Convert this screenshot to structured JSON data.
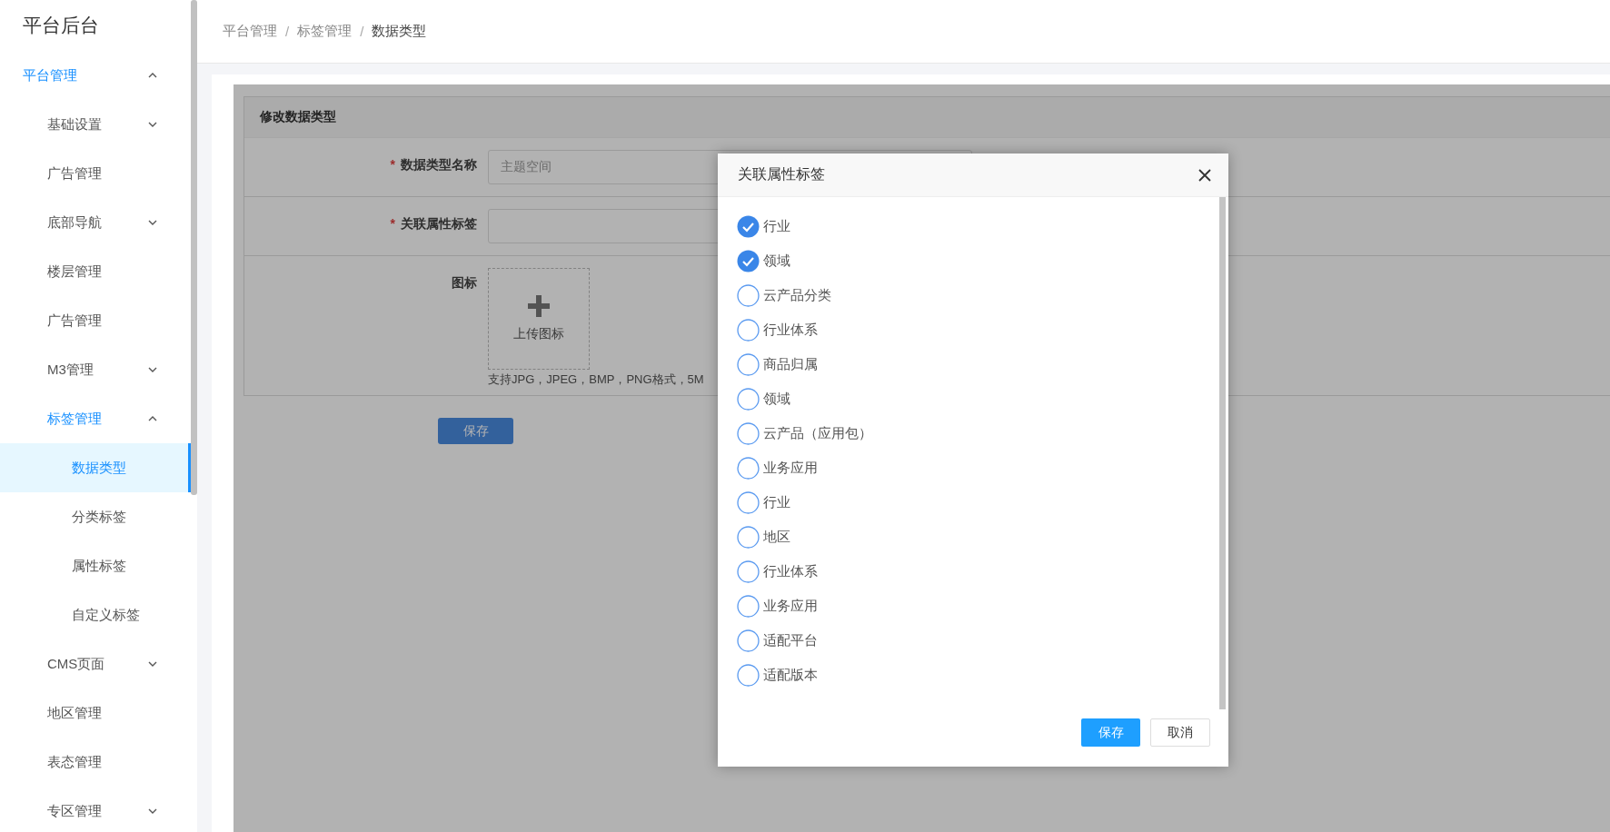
{
  "sidebar": {
    "title": "平台后台",
    "items": [
      {
        "label": "平台管理",
        "kind": "submenu",
        "expanded": true,
        "selected": false,
        "active": true,
        "children": [
          {
            "label": "基础设置",
            "kind": "submenu",
            "expanded": false,
            "selected": false,
            "active": false
          },
          {
            "label": "广告管理",
            "kind": "item",
            "selected": false
          },
          {
            "label": "底部导航",
            "kind": "submenu",
            "expanded": false,
            "selected": false,
            "active": false
          },
          {
            "label": "楼层管理",
            "kind": "item",
            "selected": false
          },
          {
            "label": "广告管理",
            "kind": "item",
            "selected": false
          },
          {
            "label": "M3管理",
            "kind": "submenu",
            "expanded": false,
            "selected": false,
            "active": false
          },
          {
            "label": "标签管理",
            "kind": "submenu",
            "expanded": true,
            "selected": false,
            "active": true,
            "children": [
              {
                "label": "数据类型",
                "kind": "item",
                "selected": true
              },
              {
                "label": "分类标签",
                "kind": "item",
                "selected": false
              },
              {
                "label": "属性标签",
                "kind": "item",
                "selected": false
              },
              {
                "label": "自定义标签",
                "kind": "item",
                "selected": false
              }
            ]
          },
          {
            "label": "CMS页面",
            "kind": "submenu",
            "expanded": false,
            "selected": false,
            "active": false
          },
          {
            "label": "地区管理",
            "kind": "item",
            "selected": false
          },
          {
            "label": "表态管理",
            "kind": "item",
            "selected": false
          },
          {
            "label": "专区管理",
            "kind": "submenu",
            "expanded": false,
            "selected": false,
            "active": false
          }
        ]
      }
    ]
  },
  "breadcrumb": [
    {
      "text": "平台管理",
      "kind": "link",
      "current": false
    },
    {
      "text": "/",
      "kind": "separator"
    },
    {
      "text": "标签管理",
      "kind": "link",
      "current": false
    },
    {
      "text": "/",
      "kind": "separator"
    },
    {
      "text": "数据类型",
      "kind": "link",
      "current": true
    }
  ],
  "form": {
    "title": "修改数据类型",
    "fields": [
      {
        "label": "数据类型名称",
        "required_mark": "*",
        "kind": "text",
        "value": "主题空间"
      },
      {
        "label": "关联属性标签",
        "required_mark": "*",
        "kind": "text"
      },
      {
        "label": "图标",
        "kind": "upload",
        "upload_label": "上传图标",
        "hint": "支持JPG，JPEG，BMP，PNG格式，5M"
      }
    ],
    "save_button": "保存"
  },
  "dialog": {
    "title": "关联属性标签",
    "options": [
      {
        "label": "行业",
        "checked": true
      },
      {
        "label": "领域",
        "checked": true
      },
      {
        "label": "云产品分类",
        "checked": false
      },
      {
        "label": "行业体系",
        "checked": false
      },
      {
        "label": "商品归属",
        "checked": false
      },
      {
        "label": "领域",
        "checked": false
      },
      {
        "label": "云产品（应用包）",
        "checked": false
      },
      {
        "label": "业务应用",
        "checked": false
      },
      {
        "label": "行业",
        "checked": false
      },
      {
        "label": "地区",
        "checked": false
      },
      {
        "label": "行业体系",
        "checked": false
      },
      {
        "label": "业务应用",
        "checked": false
      },
      {
        "label": "适配平台",
        "checked": false
      },
      {
        "label": "适配版本",
        "checked": false
      }
    ],
    "save_button": "保存",
    "cancel_button": "取消"
  }
}
